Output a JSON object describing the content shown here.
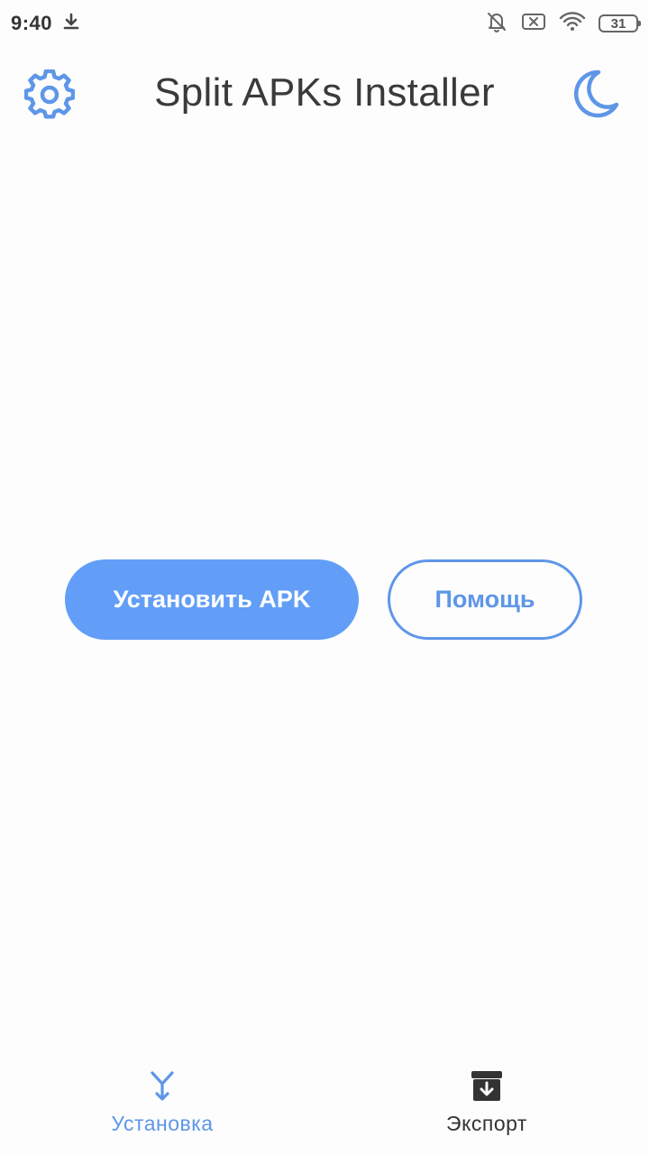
{
  "status_bar": {
    "time": "9:40",
    "battery_level": "31",
    "icons": [
      "download-icon",
      "bell-off-icon",
      "sim-x-icon",
      "wifi-icon",
      "battery-icon"
    ]
  },
  "app_bar": {
    "title": "Split APKs Installer",
    "left_icon": "gear-icon",
    "right_icon": "moon-icon"
  },
  "actions": {
    "install_label": "Установить APK",
    "help_label": "Помощь"
  },
  "bottom_nav": {
    "items": [
      {
        "label": "Установка",
        "icon": "merge-arrow-icon",
        "active": true
      },
      {
        "label": "Экспорт",
        "icon": "archive-download-icon",
        "active": false
      }
    ]
  },
  "colors": {
    "accent": "#629ef7",
    "accent_outline": "#5e96e8",
    "title_text": "#3a3a3a",
    "background": "#fdfdfd"
  }
}
